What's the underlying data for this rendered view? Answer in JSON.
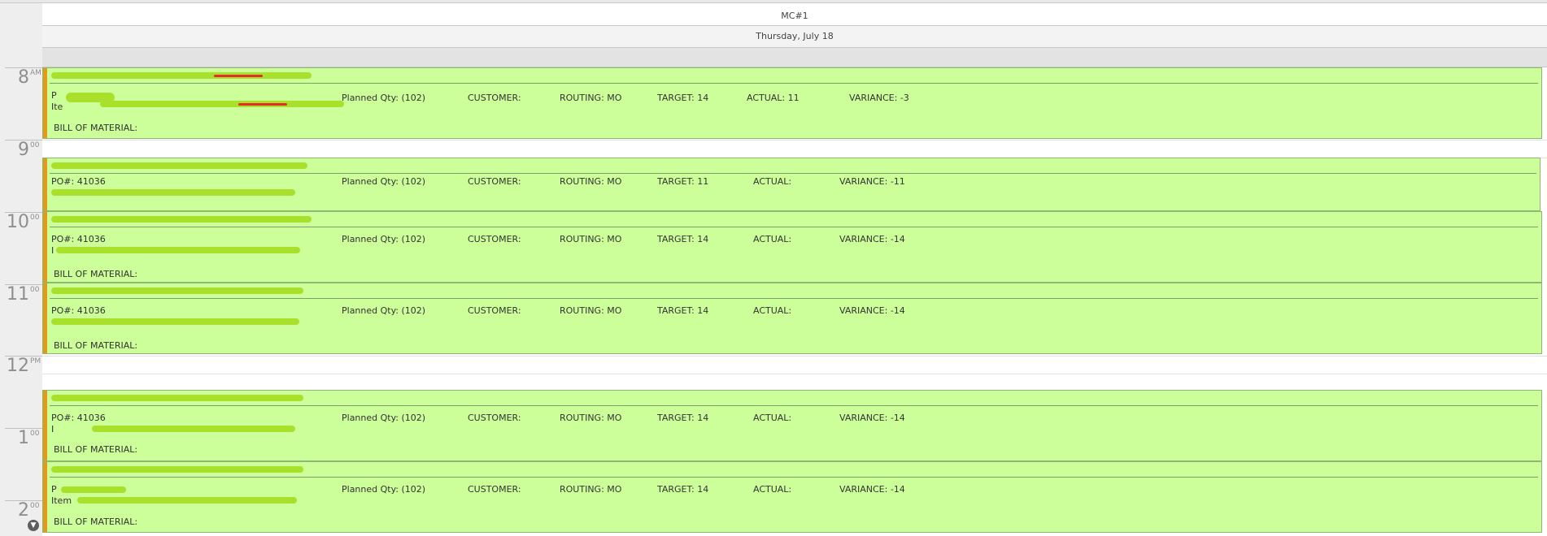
{
  "header": {
    "resource": "MC#1",
    "date": "Thursday, July 18"
  },
  "time_slots": [
    {
      "num": "8",
      "suffix": "AM"
    },
    {
      "num": "9",
      "suffix": "00"
    },
    {
      "num": "10",
      "suffix": "00"
    },
    {
      "num": "11",
      "suffix": "00"
    },
    {
      "num": "12",
      "suffix": "PM"
    },
    {
      "num": "1",
      "suffix": "00"
    },
    {
      "num": "2",
      "suffix": "00"
    }
  ],
  "appointments": [
    {
      "po": "P",
      "item": "Ite",
      "planned": "Planned Qty: (102)",
      "customer": "CUSTOMER:",
      "routing": "ROUTING: MO",
      "target": "TARGET: 14",
      "actual": "ACTUAL: 11",
      "variance": "VARIANCE: -3",
      "bom": "BILL OF MATERIAL:"
    },
    {
      "po": "PO#: 41036",
      "item": "",
      "planned": "Planned Qty: (102)",
      "customer": "CUSTOMER:",
      "routing": "ROUTING: MO",
      "target": "TARGET: 11",
      "actual": "ACTUAL:",
      "variance": "VARIANCE: -11",
      "bom": ""
    },
    {
      "po": "PO#: 41036",
      "item": "I",
      "planned": "Planned Qty: (102)",
      "customer": "CUSTOMER:",
      "routing": "ROUTING: MO",
      "target": "TARGET: 14",
      "actual": "ACTUAL:",
      "variance": "VARIANCE: -14",
      "bom": "BILL OF MATERIAL:"
    },
    {
      "po": "PO#: 41036",
      "item": "",
      "planned": "Planned Qty: (102)",
      "customer": "CUSTOMER:",
      "routing": "ROUTING: MO",
      "target": "TARGET: 14",
      "actual": "ACTUAL:",
      "variance": "VARIANCE: -14",
      "bom": "BILL OF MATERIAL:"
    },
    {
      "po": "PO#: 41036",
      "item": "I",
      "planned": "Planned Qty: (102)",
      "customer": "CUSTOMER:",
      "routing": "ROUTING: MO",
      "target": "TARGET: 14",
      "actual": "ACTUAL:",
      "variance": "VARIANCE: -14",
      "bom": "BILL OF MATERIAL:"
    },
    {
      "po": "P",
      "item": "Item",
      "planned": "Planned Qty: (102)",
      "customer": "CUSTOMER:",
      "routing": "ROUTING: MO",
      "target": "TARGET: 14",
      "actual": "ACTUAL:",
      "variance": "VARIANCE: -14",
      "bom": "BILL OF MATERIAL:"
    }
  ],
  "icons": {
    "scroll_down": "chevron-down-icon"
  },
  "colors": {
    "appointment_bg": "#ccff99",
    "status_stripe": "#e39a1a"
  }
}
